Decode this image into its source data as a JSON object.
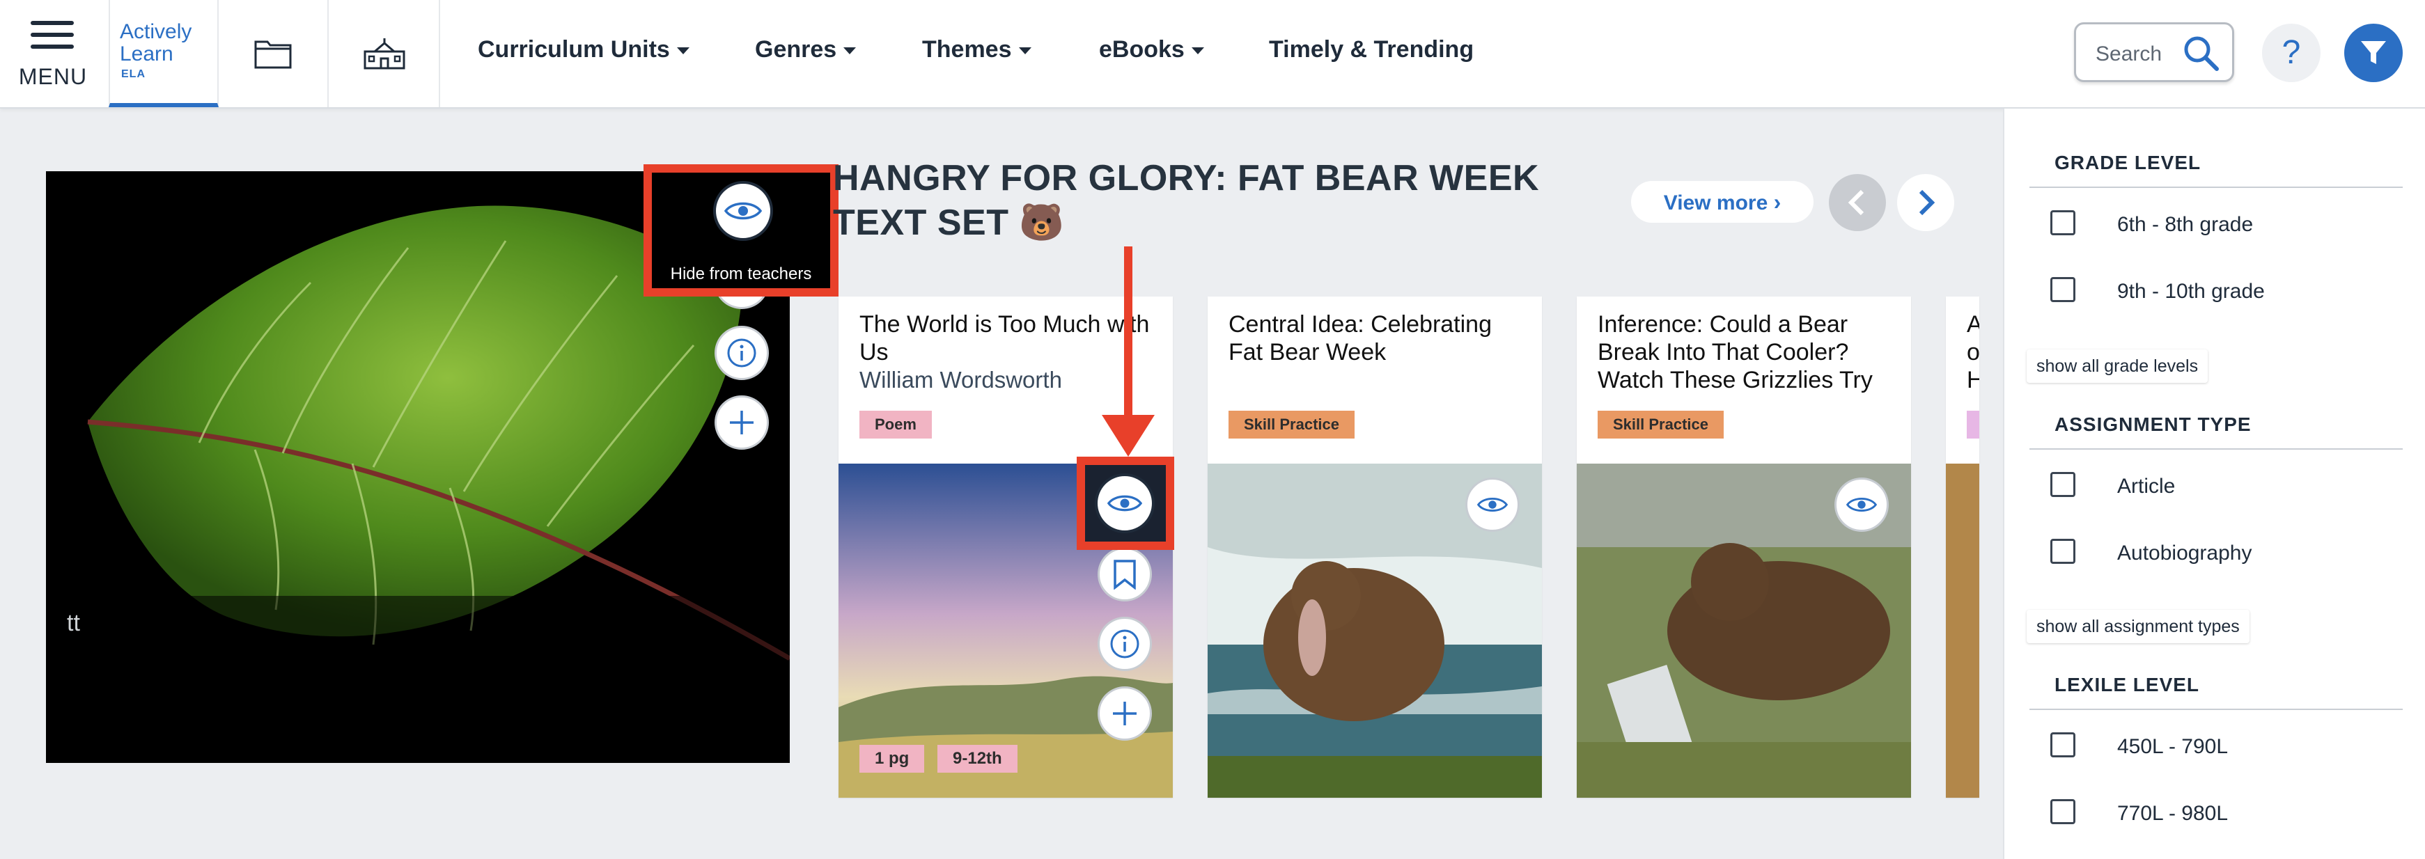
{
  "nav": {
    "menu_label": "MENU",
    "logo": {
      "line1": "Actively",
      "line2": "Learn",
      "line3": "ELA"
    },
    "items": [
      {
        "label": "Curriculum Units",
        "dropdown": true
      },
      {
        "label": "Genres",
        "dropdown": true
      },
      {
        "label": "Themes",
        "dropdown": true
      },
      {
        "label": "eBooks",
        "dropdown": true
      },
      {
        "label": "Timely & Trending",
        "dropdown": false
      }
    ],
    "search_placeholder": "Search",
    "help_label": "?"
  },
  "hero": {
    "overlay_text": "tt",
    "callout_text": "Hide from teachers"
  },
  "text_set": {
    "title": "HANGRY FOR GLORY: FAT BEAR WEEK TEXT SET 🐻",
    "view_more": "View more",
    "cards": [
      {
        "title": "The World is Too Much with Us",
        "author": "William Wordsworth",
        "tag": "Poem",
        "meta": [
          "1 pg",
          "9-12th"
        ]
      },
      {
        "title": "Central Idea: Celebrating Fat Bear Week",
        "author": "",
        "tag": "Skill Practice",
        "meta": []
      },
      {
        "title": "Inference: Could a Bear Break Into That Cooler? Watch These Grizzlies Try",
        "author": "",
        "tag": "Skill Practice",
        "meta": []
      },
      {
        "title": "A o H",
        "author": "",
        "tag": "",
        "meta": []
      }
    ]
  },
  "sidebar": {
    "grade_level": {
      "heading": "GRADE LEVEL",
      "options": [
        "6th - 8th grade",
        "9th - 10th grade"
      ],
      "show_all": "show all grade levels"
    },
    "assignment_type": {
      "heading": "ASSIGNMENT TYPE",
      "options": [
        "Article",
        "Autobiography"
      ],
      "show_all": "show all assignment types"
    },
    "lexile_level": {
      "heading": "LEXILE LEVEL",
      "options": [
        "450L - 790L",
        "770L - 980L"
      ]
    }
  },
  "colors": {
    "brand_blue": "#2b6fc4",
    "highlight_red": "#e8402a",
    "poem_tag": "#f1b4c3",
    "skill_tag": "#e99963"
  }
}
